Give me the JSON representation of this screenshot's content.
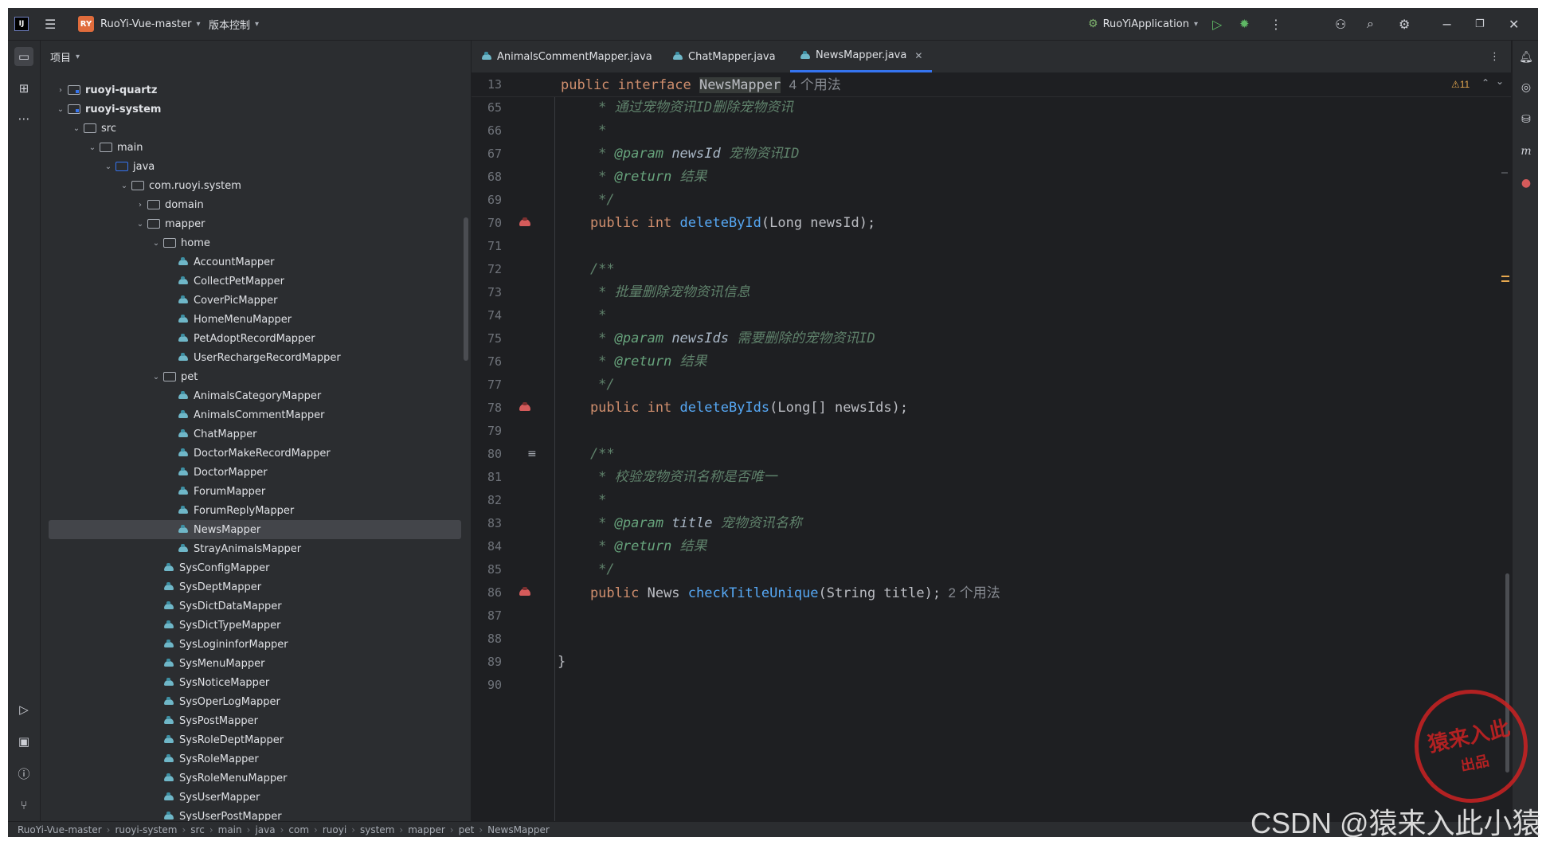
{
  "topbar": {
    "logo": "IJ",
    "project_badge": "RY",
    "project_name": "RuoYi-Vue-master",
    "vcs_label": "版本控制",
    "run_config": "RuoYiApplication"
  },
  "project_panel": {
    "title": "项目",
    "tree": [
      {
        "label": "ruoyi-quartz",
        "bold": true
      },
      {
        "label": "ruoyi-system",
        "bold": true
      },
      {
        "label": "src"
      },
      {
        "label": "main"
      },
      {
        "label": "java"
      },
      {
        "label": "com.ruoyi.system"
      },
      {
        "label": "domain"
      },
      {
        "label": "mapper"
      },
      {
        "label": "home"
      },
      {
        "label": "AccountMapper"
      },
      {
        "label": "CollectPetMapper"
      },
      {
        "label": "CoverPicMapper"
      },
      {
        "label": "HomeMenuMapper"
      },
      {
        "label": "PetAdoptRecordMapper"
      },
      {
        "label": "UserRechargeRecordMapper"
      },
      {
        "label": "pet"
      },
      {
        "label": "AnimalsCategoryMapper"
      },
      {
        "label": "AnimalsCommentMapper"
      },
      {
        "label": "ChatMapper"
      },
      {
        "label": "DoctorMakeRecordMapper"
      },
      {
        "label": "DoctorMapper"
      },
      {
        "label": "ForumMapper"
      },
      {
        "label": "ForumReplyMapper"
      },
      {
        "label": "NewsMapper"
      },
      {
        "label": "StrayAnimalsMapper"
      },
      {
        "label": "SysConfigMapper"
      },
      {
        "label": "SysDeptMapper"
      },
      {
        "label": "SysDictDataMapper"
      },
      {
        "label": "SysDictTypeMapper"
      },
      {
        "label": "SysLogininforMapper"
      },
      {
        "label": "SysMenuMapper"
      },
      {
        "label": "SysNoticeMapper"
      },
      {
        "label": "SysOperLogMapper"
      },
      {
        "label": "SysPostMapper"
      },
      {
        "label": "SysRoleDeptMapper"
      },
      {
        "label": "SysRoleMapper"
      },
      {
        "label": "SysRoleMenuMapper"
      },
      {
        "label": "SysUserMapper"
      },
      {
        "label": "SysUserPostMapper"
      }
    ]
  },
  "tabs": [
    {
      "label": "AnimalsCommentMapper.java"
    },
    {
      "label": "ChatMapper.java"
    },
    {
      "label": "NewsMapper.java",
      "active": true
    }
  ],
  "editor": {
    "sticky_line_number": "13",
    "sticky_kw": "public interface",
    "sticky_name": "NewsMapper",
    "sticky_hint": "4 个用法",
    "warning_count": "11",
    "line_numbers": [
      "65",
      "66",
      "67",
      "68",
      "69",
      "70",
      "71",
      "72",
      "73",
      "74",
      "75",
      "76",
      "77",
      "78",
      "79",
      "80",
      "81",
      "82",
      "83",
      "84",
      "85",
      "86",
      "87",
      "88",
      "89",
      "90"
    ],
    "lines": {
      "l65_star": "     * ",
      "l65_text": "通过宠物资讯ID删除宠物资讯",
      "l66": "     *",
      "l67_star": "     * ",
      "l67_tag": "@param",
      "l67_name": " newsId ",
      "l67_text": "宠物资讯ID",
      "l68_star": "     * ",
      "l68_tag": "@return",
      "l68_text": " 结果",
      "l69": "     */",
      "l70_kw": "    public int ",
      "l70_fn": "deleteById",
      "l70_rest": "(Long newsId);",
      "l72": "    /**",
      "l73_star": "     * ",
      "l73_text": "批量删除宠物资讯信息",
      "l74": "     *",
      "l75_star": "     * ",
      "l75_tag": "@param",
      "l75_name": " newsIds ",
      "l75_text": "需要删除的宠物资讯ID",
      "l76_star": "     * ",
      "l76_tag": "@return",
      "l76_text": " 结果",
      "l77": "     */",
      "l78_kw": "    public int ",
      "l78_fn": "deleteByIds",
      "l78_rest": "(Long[] newsIds);",
      "l80": "    /**",
      "l81_star": "     * ",
      "l81_text": "校验宠物资讯名称是否唯一",
      "l82": "     *",
      "l83_star": "     * ",
      "l83_tag": "@param",
      "l83_name": " title ",
      "l83_text": "宠物资讯名称",
      "l84_star": "     * ",
      "l84_tag": "@return",
      "l84_text": " 结果",
      "l85": "     */",
      "l86_kw": "    public ",
      "l86_type": "News ",
      "l86_fn": "checkTitleUnique",
      "l86_rest": "(String title);",
      "l86_hint": "  2 个用法",
      "l89": "}"
    }
  },
  "breadcrumb": [
    "RuoYi-Vue-master",
    "ruoyi-system",
    "src",
    "main",
    "java",
    "com",
    "ruoyi",
    "system",
    "mapper",
    "pet",
    "NewsMapper"
  ],
  "watermark": {
    "csdn": "CSDN @猿来入此小猿",
    "seal_main": "猿来入此",
    "seal_sub": "出品"
  },
  "colors": {
    "accent": "#3574f0",
    "keyword": "#cf8e6d",
    "function": "#56a8f5",
    "comment": "#5f826b"
  }
}
